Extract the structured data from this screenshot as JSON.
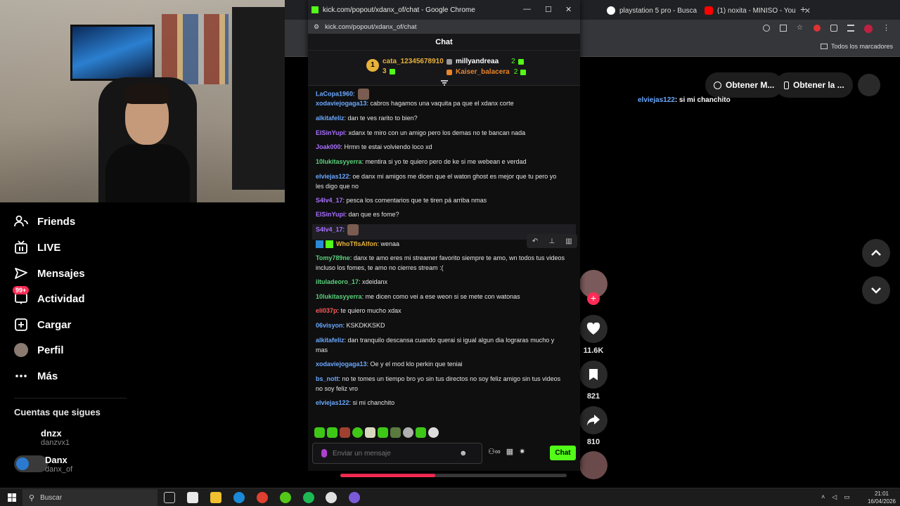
{
  "colors": {
    "kick_green": "#53fc18",
    "tiktok_red": "#fe2c55",
    "purple_user": "#a970ff",
    "blue_user": "#6aa8ff"
  },
  "sidebar": {
    "items": [
      {
        "label": "Friends",
        "icon": "friends-icon"
      },
      {
        "label": "LIVE",
        "icon": "live-icon"
      },
      {
        "label": "Mensajes",
        "icon": "messages-icon"
      },
      {
        "label": "Actividad",
        "icon": "activity-icon",
        "badge": "99+"
      },
      {
        "label": "Cargar",
        "icon": "upload-icon"
      },
      {
        "label": "Perfil",
        "icon": "profile-avatar"
      },
      {
        "label": "Más",
        "icon": "more-icon"
      }
    ],
    "following_title": "Cuentas que sigues",
    "following": [
      {
        "name": "dnzx",
        "user": "danzvx1"
      },
      {
        "name": "Danx",
        "user": "danx_of"
      }
    ]
  },
  "bg_browser": {
    "tabs": [
      {
        "label": "playstation 5 pro - Busca"
      },
      {
        "label": "(1) noxita - MINISO - You"
      }
    ],
    "bookmarks_label": "Todos los marcadores"
  },
  "bg_page": {
    "pill1": "Obtener M...",
    "pill2": "Obtener la ...",
    "chat_user": "elviejas122",
    "chat_text": ": si mi chanchito"
  },
  "actions": {
    "likes": "11.6K",
    "saves": "821",
    "shares": "810"
  },
  "popout": {
    "window_title": "kick.com/popout/xdanx_of/chat - Google Chrome",
    "url": "kick.com/popout/xdanx_of/chat",
    "chat_header": "Chat",
    "leaders": [
      {
        "name": "cata_12345678910",
        "count": "3"
      },
      {
        "name": "millyandreaa",
        "count": "2"
      },
      {
        "name": "Kaiser_balacera",
        "count": "2"
      }
    ],
    "leader_rank": "1",
    "messages": [
      {
        "user": "LaCopa1960",
        "text": ":",
        "color": "#6aa8ff"
      },
      {
        "user": "xodaviejogaga13",
        "text": ": cabros hagamos una vaquita pa que el xdanx corte",
        "color": "#6aa8ff"
      },
      {
        "user": "alkitafeliz",
        "text": ": dan te ves raritо to bien?",
        "color": "#6aa8ff"
      },
      {
        "user": "ElSinYupi",
        "text": ": xdanx te miro con un amigo pero los demas no te bancan nada",
        "color": "#a970ff"
      },
      {
        "user": "Joak000",
        "text": ": Hrmn te estai volviendo loco xd",
        "color": "#a970ff"
      },
      {
        "user": "10lukitasyyerra",
        "text": ": mentira si yo te quiero pero de ke si me webean e verdad",
        "color": "#5ad17a"
      },
      {
        "user": "elviejas122",
        "text": ": oe danx mi amigos me dicen que el waton ghost es mejor que tu pero yo les digo que no",
        "color": "#6aa8ff"
      },
      {
        "user": "S4lv4_17",
        "text": ": pesca los comentarios que te tiren pá arriba nmas",
        "color": "#a970ff"
      },
      {
        "user": "ElSinYupi",
        "text": ": dan que es fome?",
        "color": "#a970ff"
      },
      {
        "user": "S4lv4_17",
        "text": ":",
        "color": "#a970ff"
      },
      {
        "user": "WhoTflsAlfon",
        "text": ": wenaa",
        "color": "#e8b23a"
      },
      {
        "user": "Tomy789ne",
        "text": ": danx te amo eres mi streamer favorito siempre te amo, wn todos tus videos incluso los fomes, te amo no cierres stream :(",
        "color": "#5ad17a"
      },
      {
        "user": "iltuladeoro_17",
        "text": ": xdeidanx",
        "color": "#5ad17a"
      },
      {
        "user": "10lukitasyyerra",
        "text": ": me dicen como vei a ese weon si se mete con watonas",
        "color": "#5ad17a"
      },
      {
        "user": "eli037p",
        "text": ": te quiero mucho xdax",
        "color": "#ff5a5a"
      },
      {
        "user": "06visyon",
        "text": ": KSKDKKSKD",
        "color": "#6aa8ff"
      },
      {
        "user": "alkitafeliz",
        "text": ": dan tranquilo descansa cuando querai si igual algun dia lograras mucho y mas",
        "color": "#6aa8ff"
      },
      {
        "user": "xodaviejogaga13",
        "text": ": Oe y el mod klo perkin que teniai",
        "color": "#6aa8ff"
      },
      {
        "user": "bs_nott",
        "text": ": no te tomes un tiempo bro yo sin tus directos no soy feliz amigo sin tus videos no soy feliz vro",
        "color": "#6aa8ff"
      },
      {
        "user": "elviejas122",
        "text": ": si mi chanchito",
        "color": "#6aa8ff"
      }
    ],
    "input_placeholder": "Enviar un mensaje",
    "send_label": "Chat"
  },
  "video_progress": 0.42,
  "taskbar": {
    "search_placeholder": "Buscar",
    "time": "21:01",
    "date": "16/04/2026"
  }
}
